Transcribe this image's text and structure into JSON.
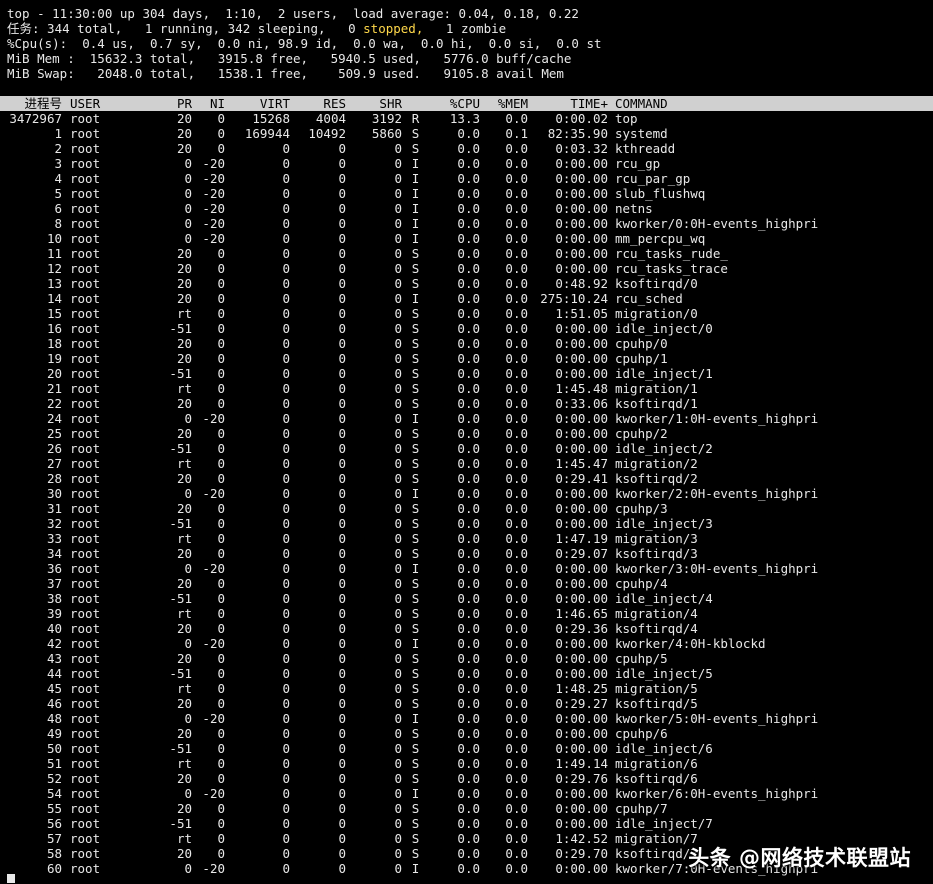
{
  "summary": {
    "line1": "top - 11:30:00 up 304 days,  1:10,  2 users,  load average: 0.04, 0.18, 0.22",
    "line2_a": "任务: 344 total,   1 running, 342 sleeping,   0 ",
    "line2_stopped": "stopped,",
    "line2_b": "   1 zombie",
    "line3": "%Cpu(s):  0.4 us,  0.7 sy,  0.0 ni, 98.9 id,  0.0 wa,  0.0 hi,  0.0 si,  0.0 st",
    "line4": "MiB Mem :  15632.3 total,   3915.8 free,   5940.5 used,   5776.0 buff/cache",
    "line5": "MiB Swap:   2048.0 total,   1538.1 free,    509.9 used.   9105.8 avail Mem"
  },
  "header": {
    "pid": "进程号",
    "user": "USER",
    "pr": "PR",
    "ni": "NI",
    "virt": "VIRT",
    "res": "RES",
    "shr": "SHR",
    "s": "",
    "cpu": "%CPU",
    "mem": "%MEM",
    "time": "TIME+",
    "cmd": "COMMAND"
  },
  "processes": [
    [
      "3472967",
      "root",
      "20",
      "0",
      "15268",
      "4004",
      "3192",
      "R",
      "13.3",
      "0.0",
      "0:00.02",
      "top"
    ],
    [
      "1",
      "root",
      "20",
      "0",
      "169944",
      "10492",
      "5860",
      "S",
      "0.0",
      "0.1",
      "82:35.90",
      "systemd"
    ],
    [
      "2",
      "root",
      "20",
      "0",
      "0",
      "0",
      "0",
      "S",
      "0.0",
      "0.0",
      "0:03.32",
      "kthreadd"
    ],
    [
      "3",
      "root",
      "0",
      "-20",
      "0",
      "0",
      "0",
      "I",
      "0.0",
      "0.0",
      "0:00.00",
      "rcu_gp"
    ],
    [
      "4",
      "root",
      "0",
      "-20",
      "0",
      "0",
      "0",
      "I",
      "0.0",
      "0.0",
      "0:00.00",
      "rcu_par_gp"
    ],
    [
      "5",
      "root",
      "0",
      "-20",
      "0",
      "0",
      "0",
      "I",
      "0.0",
      "0.0",
      "0:00.00",
      "slub_flushwq"
    ],
    [
      "6",
      "root",
      "0",
      "-20",
      "0",
      "0",
      "0",
      "I",
      "0.0",
      "0.0",
      "0:00.00",
      "netns"
    ],
    [
      "8",
      "root",
      "0",
      "-20",
      "0",
      "0",
      "0",
      "I",
      "0.0",
      "0.0",
      "0:00.00",
      "kworker/0:0H-events_highpri"
    ],
    [
      "10",
      "root",
      "0",
      "-20",
      "0",
      "0",
      "0",
      "I",
      "0.0",
      "0.0",
      "0:00.00",
      "mm_percpu_wq"
    ],
    [
      "11",
      "root",
      "20",
      "0",
      "0",
      "0",
      "0",
      "S",
      "0.0",
      "0.0",
      "0:00.00",
      "rcu_tasks_rude_"
    ],
    [
      "12",
      "root",
      "20",
      "0",
      "0",
      "0",
      "0",
      "S",
      "0.0",
      "0.0",
      "0:00.00",
      "rcu_tasks_trace"
    ],
    [
      "13",
      "root",
      "20",
      "0",
      "0",
      "0",
      "0",
      "S",
      "0.0",
      "0.0",
      "0:48.92",
      "ksoftirqd/0"
    ],
    [
      "14",
      "root",
      "20",
      "0",
      "0",
      "0",
      "0",
      "I",
      "0.0",
      "0.0",
      "275:10.24",
      "rcu_sched"
    ],
    [
      "15",
      "root",
      "rt",
      "0",
      "0",
      "0",
      "0",
      "S",
      "0.0",
      "0.0",
      "1:51.05",
      "migration/0"
    ],
    [
      "16",
      "root",
      "-51",
      "0",
      "0",
      "0",
      "0",
      "S",
      "0.0",
      "0.0",
      "0:00.00",
      "idle_inject/0"
    ],
    [
      "18",
      "root",
      "20",
      "0",
      "0",
      "0",
      "0",
      "S",
      "0.0",
      "0.0",
      "0:00.00",
      "cpuhp/0"
    ],
    [
      "19",
      "root",
      "20",
      "0",
      "0",
      "0",
      "0",
      "S",
      "0.0",
      "0.0",
      "0:00.00",
      "cpuhp/1"
    ],
    [
      "20",
      "root",
      "-51",
      "0",
      "0",
      "0",
      "0",
      "S",
      "0.0",
      "0.0",
      "0:00.00",
      "idle_inject/1"
    ],
    [
      "21",
      "root",
      "rt",
      "0",
      "0",
      "0",
      "0",
      "S",
      "0.0",
      "0.0",
      "1:45.48",
      "migration/1"
    ],
    [
      "22",
      "root",
      "20",
      "0",
      "0",
      "0",
      "0",
      "S",
      "0.0",
      "0.0",
      "0:33.06",
      "ksoftirqd/1"
    ],
    [
      "24",
      "root",
      "0",
      "-20",
      "0",
      "0",
      "0",
      "I",
      "0.0",
      "0.0",
      "0:00.00",
      "kworker/1:0H-events_highpri"
    ],
    [
      "25",
      "root",
      "20",
      "0",
      "0",
      "0",
      "0",
      "S",
      "0.0",
      "0.0",
      "0:00.00",
      "cpuhp/2"
    ],
    [
      "26",
      "root",
      "-51",
      "0",
      "0",
      "0",
      "0",
      "S",
      "0.0",
      "0.0",
      "0:00.00",
      "idle_inject/2"
    ],
    [
      "27",
      "root",
      "rt",
      "0",
      "0",
      "0",
      "0",
      "S",
      "0.0",
      "0.0",
      "1:45.47",
      "migration/2"
    ],
    [
      "28",
      "root",
      "20",
      "0",
      "0",
      "0",
      "0",
      "S",
      "0.0",
      "0.0",
      "0:29.41",
      "ksoftirqd/2"
    ],
    [
      "30",
      "root",
      "0",
      "-20",
      "0",
      "0",
      "0",
      "I",
      "0.0",
      "0.0",
      "0:00.00",
      "kworker/2:0H-events_highpri"
    ],
    [
      "31",
      "root",
      "20",
      "0",
      "0",
      "0",
      "0",
      "S",
      "0.0",
      "0.0",
      "0:00.00",
      "cpuhp/3"
    ],
    [
      "32",
      "root",
      "-51",
      "0",
      "0",
      "0",
      "0",
      "S",
      "0.0",
      "0.0",
      "0:00.00",
      "idle_inject/3"
    ],
    [
      "33",
      "root",
      "rt",
      "0",
      "0",
      "0",
      "0",
      "S",
      "0.0",
      "0.0",
      "1:47.19",
      "migration/3"
    ],
    [
      "34",
      "root",
      "20",
      "0",
      "0",
      "0",
      "0",
      "S",
      "0.0",
      "0.0",
      "0:29.07",
      "ksoftirqd/3"
    ],
    [
      "36",
      "root",
      "0",
      "-20",
      "0",
      "0",
      "0",
      "I",
      "0.0",
      "0.0",
      "0:00.00",
      "kworker/3:0H-events_highpri"
    ],
    [
      "37",
      "root",
      "20",
      "0",
      "0",
      "0",
      "0",
      "S",
      "0.0",
      "0.0",
      "0:00.00",
      "cpuhp/4"
    ],
    [
      "38",
      "root",
      "-51",
      "0",
      "0",
      "0",
      "0",
      "S",
      "0.0",
      "0.0",
      "0:00.00",
      "idle_inject/4"
    ],
    [
      "39",
      "root",
      "rt",
      "0",
      "0",
      "0",
      "0",
      "S",
      "0.0",
      "0.0",
      "1:46.65",
      "migration/4"
    ],
    [
      "40",
      "root",
      "20",
      "0",
      "0",
      "0",
      "0",
      "S",
      "0.0",
      "0.0",
      "0:29.36",
      "ksoftirqd/4"
    ],
    [
      "42",
      "root",
      "0",
      "-20",
      "0",
      "0",
      "0",
      "I",
      "0.0",
      "0.0",
      "0:00.00",
      "kworker/4:0H-kblockd"
    ],
    [
      "43",
      "root",
      "20",
      "0",
      "0",
      "0",
      "0",
      "S",
      "0.0",
      "0.0",
      "0:00.00",
      "cpuhp/5"
    ],
    [
      "44",
      "root",
      "-51",
      "0",
      "0",
      "0",
      "0",
      "S",
      "0.0",
      "0.0",
      "0:00.00",
      "idle_inject/5"
    ],
    [
      "45",
      "root",
      "rt",
      "0",
      "0",
      "0",
      "0",
      "S",
      "0.0",
      "0.0",
      "1:48.25",
      "migration/5"
    ],
    [
      "46",
      "root",
      "20",
      "0",
      "0",
      "0",
      "0",
      "S",
      "0.0",
      "0.0",
      "0:29.27",
      "ksoftirqd/5"
    ],
    [
      "48",
      "root",
      "0",
      "-20",
      "0",
      "0",
      "0",
      "I",
      "0.0",
      "0.0",
      "0:00.00",
      "kworker/5:0H-events_highpri"
    ],
    [
      "49",
      "root",
      "20",
      "0",
      "0",
      "0",
      "0",
      "S",
      "0.0",
      "0.0",
      "0:00.00",
      "cpuhp/6"
    ],
    [
      "50",
      "root",
      "-51",
      "0",
      "0",
      "0",
      "0",
      "S",
      "0.0",
      "0.0",
      "0:00.00",
      "idle_inject/6"
    ],
    [
      "51",
      "root",
      "rt",
      "0",
      "0",
      "0",
      "0",
      "S",
      "0.0",
      "0.0",
      "1:49.14",
      "migration/6"
    ],
    [
      "52",
      "root",
      "20",
      "0",
      "0",
      "0",
      "0",
      "S",
      "0.0",
      "0.0",
      "0:29.76",
      "ksoftirqd/6"
    ],
    [
      "54",
      "root",
      "0",
      "-20",
      "0",
      "0",
      "0",
      "I",
      "0.0",
      "0.0",
      "0:00.00",
      "kworker/6:0H-events_highpri"
    ],
    [
      "55",
      "root",
      "20",
      "0",
      "0",
      "0",
      "0",
      "S",
      "0.0",
      "0.0",
      "0:00.00",
      "cpuhp/7"
    ],
    [
      "56",
      "root",
      "-51",
      "0",
      "0",
      "0",
      "0",
      "S",
      "0.0",
      "0.0",
      "0:00.00",
      "idle_inject/7"
    ],
    [
      "57",
      "root",
      "rt",
      "0",
      "0",
      "0",
      "0",
      "S",
      "0.0",
      "0.0",
      "1:42.52",
      "migration/7"
    ],
    [
      "58",
      "root",
      "20",
      "0",
      "0",
      "0",
      "0",
      "S",
      "0.0",
      "0.0",
      "0:29.70",
      "ksoftirqd/7"
    ],
    [
      "60",
      "root",
      "0",
      "-20",
      "0",
      "0",
      "0",
      "I",
      "0.0",
      "0.0",
      "0:00.00",
      "kworker/7:0H-events_highpri"
    ]
  ],
  "watermark": "头条 @网络技术联盟站",
  "colors": {
    "background": "#000000",
    "text": "#e8e8e8",
    "header_bg": "#d0d0d0",
    "stopped": "#ffd84a"
  }
}
